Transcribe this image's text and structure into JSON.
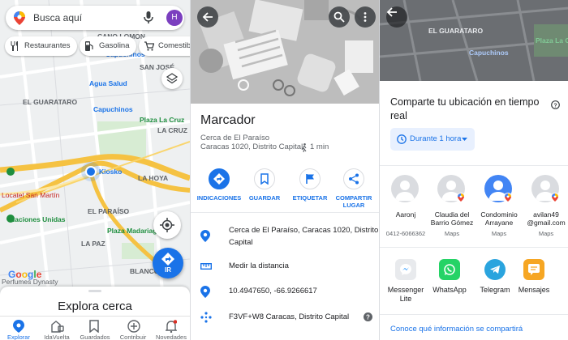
{
  "panel1": {
    "search": {
      "placeholder": "Busca aquí",
      "avatar_letter": "H"
    },
    "chips": [
      {
        "label": "Restaurantes",
        "icon": "fork-knife-icon"
      },
      {
        "label": "Gasolina",
        "icon": "gas-pump-icon"
      },
      {
        "label": "Comestibles",
        "icon": "cart-icon"
      }
    ],
    "map_labels": {
      "canolomon": "CANO LOMON",
      "san_jose": "SAN JOSÉ",
      "capuchinos_top": "Capuchinos",
      "agua_salud": "Agua Salud",
      "el_guarataro": "EL GUARATARO",
      "capuchinos": "Capuchinos",
      "plaza_la_cruz": "Plaza La Cruz",
      "la_cruz": "LA CRUZ",
      "kiosko": "Kiosko",
      "la_hoya": "LA HOYA",
      "locatel": "Locatel San Martín",
      "naciones_unidas": "Naciones Unidas",
      "el_paraiso": "EL PARAÍSO",
      "plaza_madariaga": "Plaza Madariaga",
      "la_paz": "LA PAZ",
      "blanco": "BLANCO",
      "perfumes": "Perfumes Dynasty"
    },
    "google_logo": "Google",
    "go_button": "IR",
    "sheet_title": "Explora cerca",
    "nav": [
      {
        "label": "Explorar",
        "icon": "location-pin-icon",
        "active": true
      },
      {
        "label": "IdaVuelta",
        "icon": "commute-icon",
        "active": false
      },
      {
        "label": "Guardados",
        "icon": "bookmark-icon",
        "active": false
      },
      {
        "label": "Contribuir",
        "icon": "add-circle-icon",
        "active": false
      },
      {
        "label": "Novedades",
        "icon": "bell-icon",
        "active": false
      }
    ]
  },
  "panel2": {
    "title": "Marcador",
    "subtitle_line1": "Cerca de El Paraíso",
    "subtitle_line2": "Caracas 1020, Distrito Capital",
    "walk_time": "1 min",
    "actions": [
      {
        "label": "INDICACIONES",
        "icon": "directions-icon",
        "filled": true
      },
      {
        "label": "GUARDAR",
        "icon": "bookmark-icon",
        "filled": false
      },
      {
        "label": "ETIQUETAR",
        "icon": "flag-icon",
        "filled": false
      },
      {
        "label": "COMPARTIR LUGAR",
        "icon": "share-icon",
        "filled": false
      }
    ],
    "info": {
      "address_line1": "Cerca de El Paraíso, Caracas 1020, Distrito",
      "address_line2": "Capital",
      "measure": "Medir la distancia",
      "coords": "10.4947650, -66.9266617",
      "plus_code": "F3VF+W8 Caracas, Distrito Capital"
    }
  },
  "panel3": {
    "map_labels": {
      "el_guarataro": "EL GUARATARO",
      "capuchinos": "Capuchinos",
      "plaza_la_c": "Plaza La C"
    },
    "title": "Comparte tu ubicación en tiempo real",
    "duration": "Durante 1 hora",
    "contacts": [
      {
        "name": "Aaronj",
        "sub": "0412-6066362"
      },
      {
        "name": "Claudia del Barrio Gómez",
        "sub": "Maps"
      },
      {
        "name": "Condominio Arrayane",
        "sub": "Maps"
      },
      {
        "name": "avilan49 @gmail.com",
        "sub": "Maps"
      }
    ],
    "apps": [
      {
        "name": "Messenger Lite",
        "color": "#e8eaed"
      },
      {
        "name": "WhatsApp",
        "color": "#25d366"
      },
      {
        "name": "Telegram",
        "color": "#2aa4de"
      },
      {
        "name": "Mensajes",
        "color": "#f6a623"
      }
    ],
    "footer": "Conoce qué información se compartirá"
  }
}
